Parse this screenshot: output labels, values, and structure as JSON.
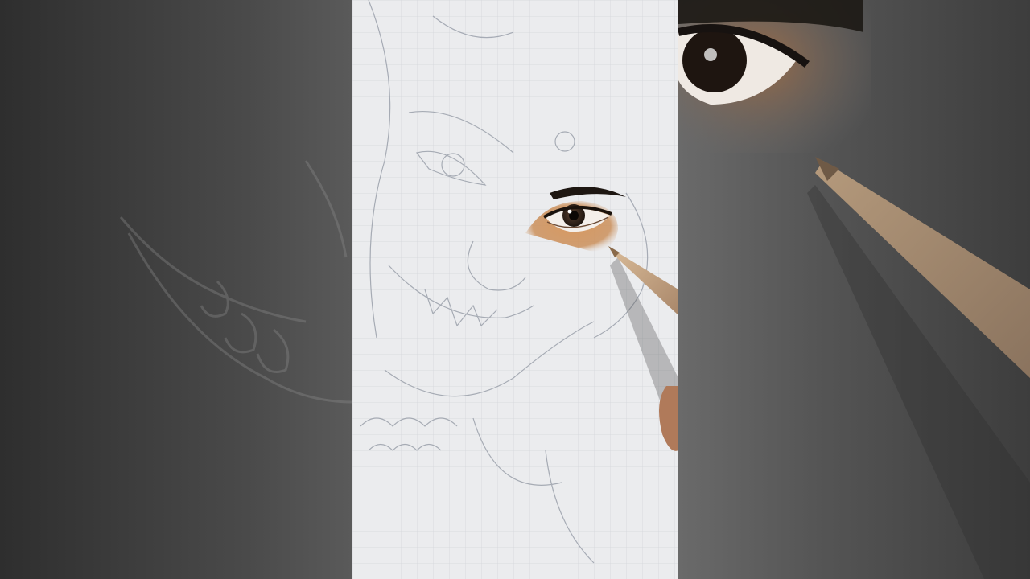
{
  "scene": {
    "kind": "vertical-video-frame",
    "subject": "pencil-portrait-in-progress",
    "colors": {
      "background_dark": "#3a3a3a",
      "paper": "#e9eaec",
      "grid": "#c9ccd2",
      "sketch_line": "#9aa0aa",
      "skin_shading": "#c98a52",
      "iris": "#2a1e16",
      "pencil_wood": "#c7a886",
      "pencil_lead": "#8a6a4a",
      "hand": "#b07a5a"
    },
    "icons": {
      "blur_left": "blurred-sketch",
      "blur_right": "blurred-eye-closeup",
      "pencil": "colored-pencil"
    }
  }
}
